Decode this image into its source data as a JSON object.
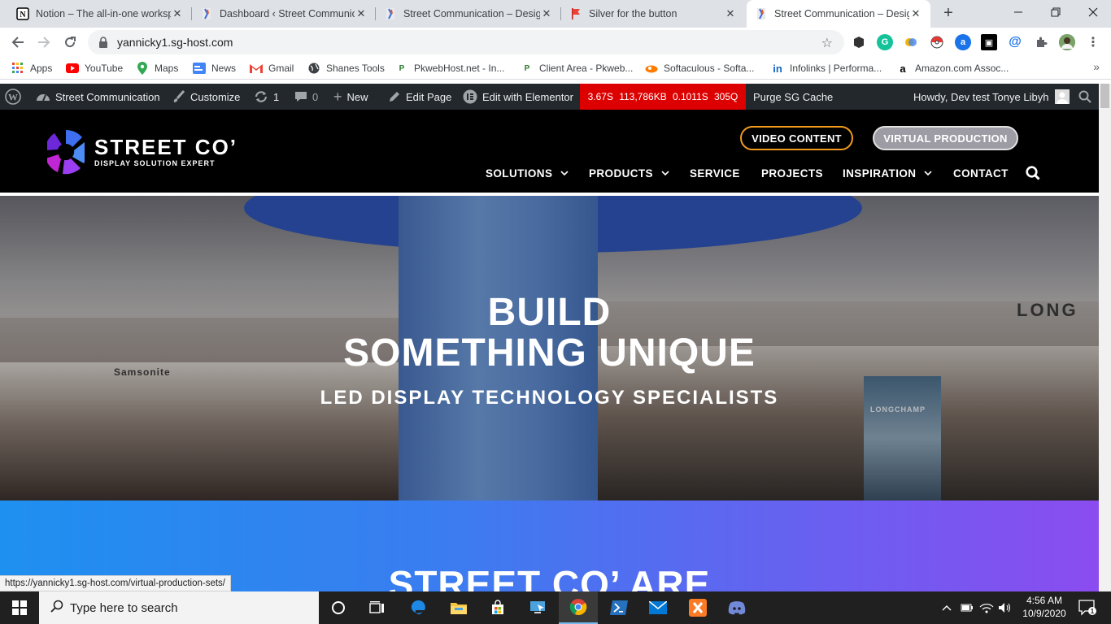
{
  "browser": {
    "tabs": [
      {
        "title": "Notion – The all-in-one workspace",
        "icon": "notion-icon"
      },
      {
        "title": "Dashboard ‹ Street Communication",
        "icon": "streetco-favicon"
      },
      {
        "title": "Street Communication – Design",
        "icon": "streetco-favicon"
      },
      {
        "title": "Silver for the button",
        "icon": "red-flag-icon"
      },
      {
        "title": "Street Communication – Design",
        "icon": "streetco-favicon",
        "active": true
      }
    ],
    "url": "yannicky1.sg-host.com",
    "status_url": "https://yannicky1.sg-host.com/virtual-production-sets/"
  },
  "bookmarks": [
    {
      "label": "Apps",
      "icon": "apps-grid-icon"
    },
    {
      "label": "YouTube",
      "icon": "youtube-icon"
    },
    {
      "label": "Maps",
      "icon": "maps-icon"
    },
    {
      "label": "News",
      "icon": "news-icon"
    },
    {
      "label": "Gmail",
      "icon": "gmail-icon"
    },
    {
      "label": "Shanes Tools",
      "icon": "globe-icon"
    },
    {
      "label": "PkwebHost.net - In...",
      "icon": "pkweb-icon"
    },
    {
      "label": "Client Area - Pkweb...",
      "icon": "pkweb-icon"
    },
    {
      "label": "Softaculous - Softa...",
      "icon": "softaculous-icon"
    },
    {
      "label": "Infolinks | Performa...",
      "icon": "infolinks-icon"
    },
    {
      "label": "Amazon.com Assoc...",
      "icon": "amazon-icon"
    }
  ],
  "adminbar": {
    "site_name": "Street Communication",
    "customize": "Customize",
    "updates": "1",
    "comments": "0",
    "new": "New",
    "edit_page": "Edit Page",
    "elementor": "Edit with Elementor",
    "qm": [
      "3.67S",
      "113,786KB",
      "0.1011S",
      "305Q"
    ],
    "purge": "Purge SG Cache",
    "howdy": "Howdy, Dev test Tonye Libyh"
  },
  "site": {
    "logo_main": "STREET CO’",
    "logo_sub": "DISPLAY SOLUTION EXPERT",
    "btn_video": "VIDEO CONTENT",
    "btn_virtual": "VIRTUAL PRODUCTION",
    "menu": [
      {
        "label": "SOLUTIONS",
        "dropdown": true
      },
      {
        "label": "PRODUCTS",
        "dropdown": true
      },
      {
        "label": "SERVICE",
        "dropdown": false
      },
      {
        "label": "PROJECTS",
        "dropdown": false
      },
      {
        "label": "INSPIRATION",
        "dropdown": true
      },
      {
        "label": "CONTACT",
        "dropdown": false
      }
    ],
    "hero_line1": "BUILD",
    "hero_line2": "SOMETHING UNIQUE",
    "hero_sub": "LED DISPLAY TECHNOLOGY SPECIALISTS",
    "hero_brands": {
      "left": "Samsonite",
      "right": "LONG",
      "poster": "LONGCHAMP"
    },
    "section_heading": "STREET CO’ ARE"
  },
  "taskbar": {
    "search_placeholder": "Type here to search",
    "time": "4:56 AM",
    "date": "10/9/2020",
    "notifications": "1"
  },
  "colors": {
    "admin_bg": "#23282d",
    "qm_red": "#dd0000",
    "video_border": "#f29b1d",
    "virtual_bg": "#9d9ba3",
    "gradient_start": "#1e90f0",
    "gradient_end": "#8b4cf0"
  }
}
